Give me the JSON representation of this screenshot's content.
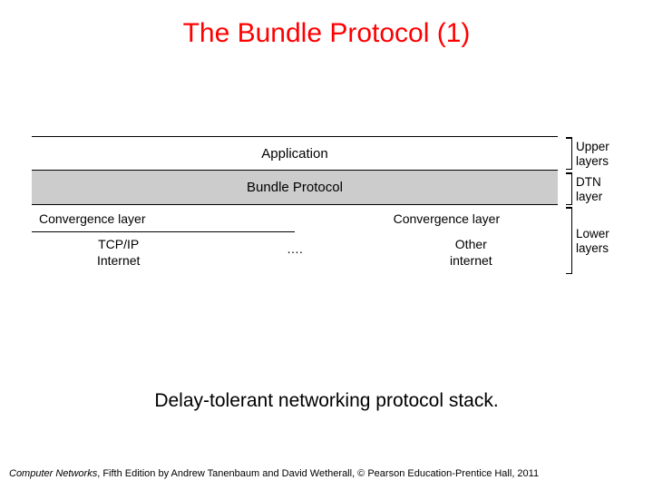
{
  "title": "The Bundle Protocol (1)",
  "layers": {
    "application": "Application",
    "bundle": "Bundle Protocol",
    "conv_left": "Convergence layer",
    "conv_right": "Convergence layer",
    "proto_left_line1": "TCP/IP",
    "proto_left_line2": "Internet",
    "proto_mid": "….",
    "proto_right_line1": "Other",
    "proto_right_line2": "internet"
  },
  "sidelabels": {
    "upper_l1": "Upper",
    "upper_l2": "layers",
    "dtn_l1": "DTN",
    "dtn_l2": "layer",
    "lower_l1": "Lower",
    "lower_l2": "layers"
  },
  "caption": "Delay-tolerant networking protocol stack.",
  "footer_book": "Computer Networks",
  "footer_rest": ", Fifth Edition by Andrew Tanenbaum and David Wetherall, © Pearson Education-Prentice Hall, 2011"
}
